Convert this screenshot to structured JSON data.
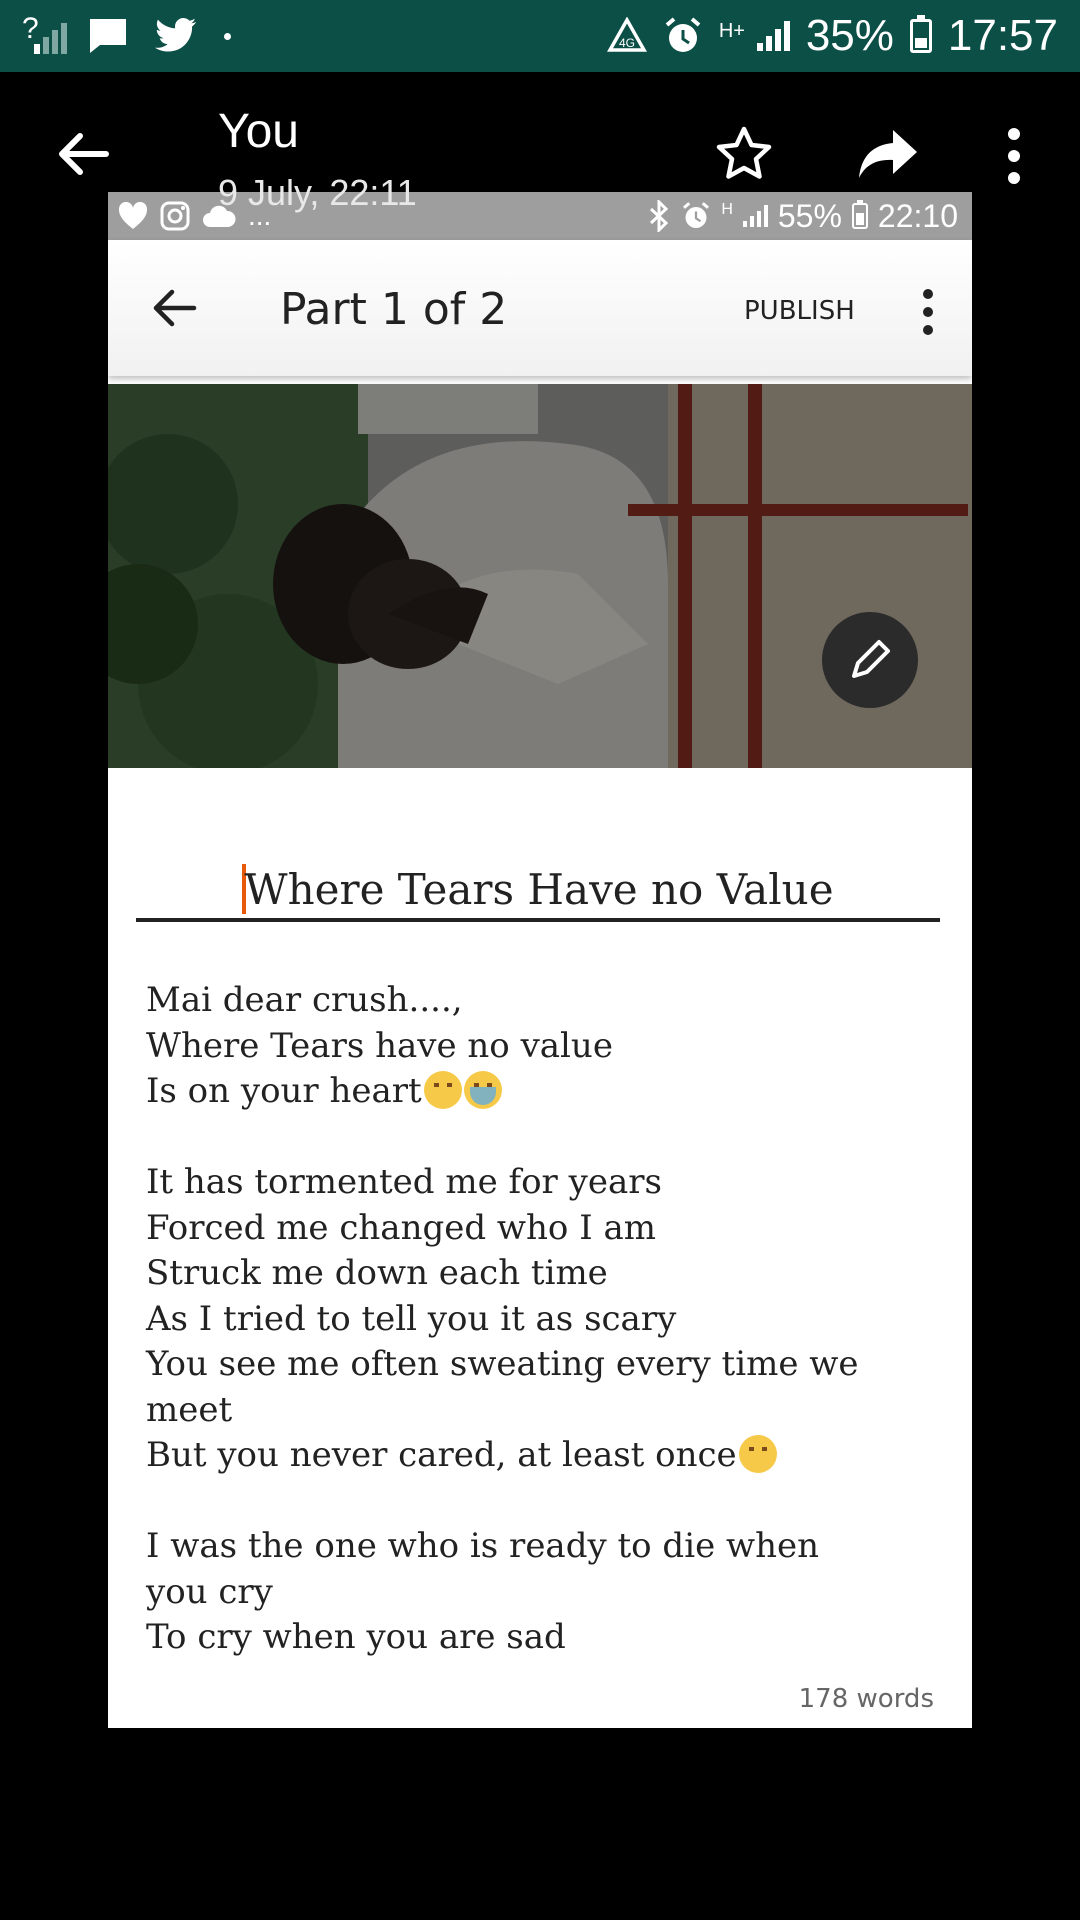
{
  "device_status": {
    "battery": "35%",
    "time": "17:57",
    "network": "H+"
  },
  "viewer": {
    "sender": "You",
    "timestamp": "9 July, 22:11"
  },
  "inner_status": {
    "battery": "55%",
    "time": "22:10",
    "network": "H",
    "overflow": "..."
  },
  "editor": {
    "part_label": "Part 1 of 2",
    "publish_label": "PUBLISH",
    "cover_page_count": 2,
    "cover_active_index": 1,
    "story_title": "Where Tears Have no Value",
    "word_count": "178 words"
  },
  "story_lines": [
    {
      "text": "Mai dear crush....,"
    },
    {
      "text": "Where Tears have no value"
    },
    {
      "text": "Is on your heart",
      "emoji": [
        "weary",
        "crying"
      ]
    },
    {
      "text": ""
    },
    {
      "text": "It has tormented me for years"
    },
    {
      "text": "Forced me changed who I am"
    },
    {
      "text": "Struck me down each time"
    },
    {
      "text": "As I tried to tell you it as scary"
    },
    {
      "text": "You see me often sweating every time we"
    },
    {
      "text": "meet"
    },
    {
      "text": "But you never cared, at least once",
      "emoji": [
        "unamused"
      ]
    },
    {
      "text": ""
    },
    {
      "text": "I was the one who is ready to die when"
    },
    {
      "text": "you cry"
    },
    {
      "text": "To cry when you are sad"
    }
  ],
  "colors": {
    "status_bar": "#0b4f47",
    "caret": "#e8590c",
    "background": "#000000"
  }
}
